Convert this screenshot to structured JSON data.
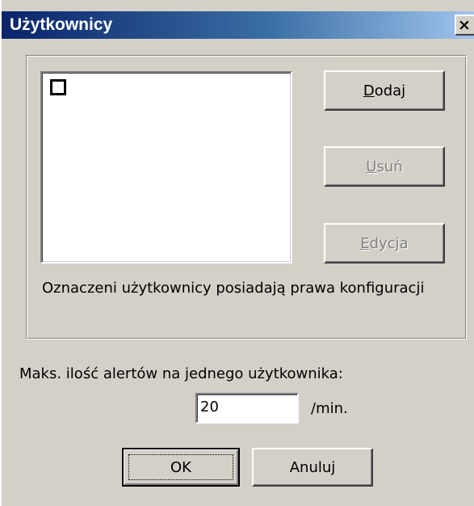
{
  "window": {
    "title": "Użytkownicy",
    "close_glyph": "×"
  },
  "users_list": {
    "items": [
      {
        "checked": false,
        "label": ""
      }
    ]
  },
  "buttons": {
    "add": {
      "prefix": "",
      "accel": "D",
      "rest": "odaj",
      "enabled": true
    },
    "remove": {
      "prefix": "",
      "accel": "U",
      "rest": "suń",
      "enabled": false
    },
    "edit": {
      "prefix": "",
      "accel": "E",
      "rest": "dycja",
      "enabled": false
    },
    "ok": "OK",
    "cancel": "Anuluj"
  },
  "note": "Oznaczeni użytkownicy posiadają prawa konfiguracji",
  "max_alerts": {
    "label": "Maks. ilość alertów na jednego użytkownika:",
    "value": "20",
    "unit": "/min."
  }
}
